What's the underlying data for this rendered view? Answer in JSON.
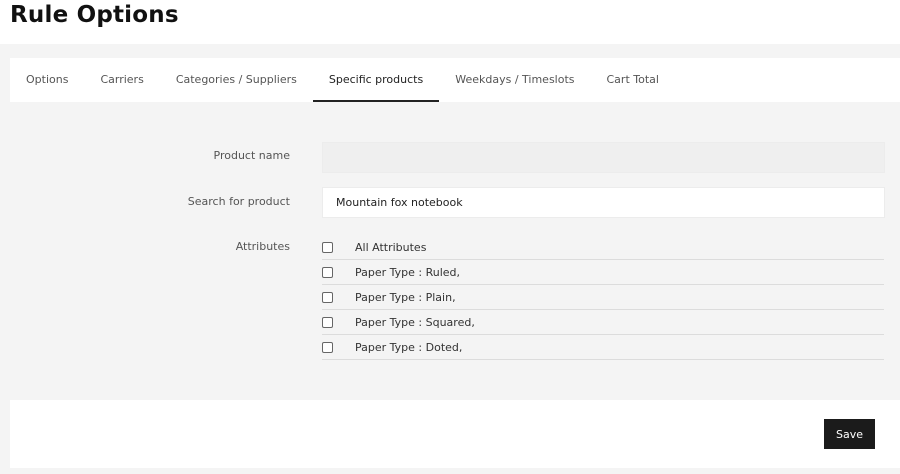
{
  "page": {
    "title": "Rule Options"
  },
  "tabs": [
    {
      "label": "Options"
    },
    {
      "label": "Carriers"
    },
    {
      "label": "Categories / Suppliers"
    },
    {
      "label": "Specific products",
      "active": true
    },
    {
      "label": "Weekdays / Timeslots"
    },
    {
      "label": "Cart Total"
    }
  ],
  "form": {
    "product_name": {
      "label": "Product name",
      "value": "",
      "placeholder": ""
    },
    "search": {
      "label": "Search for product",
      "value": "Mountain fox notebook",
      "placeholder": ""
    },
    "attributes": {
      "label": "Attributes",
      "items": [
        {
          "label": "All Attributes",
          "checked": false
        },
        {
          "label": "Paper Type : Ruled,",
          "checked": false
        },
        {
          "label": "Paper Type : Plain,",
          "checked": false
        },
        {
          "label": "Paper Type : Squared,",
          "checked": false
        },
        {
          "label": "Paper Type : Doted,",
          "checked": false
        }
      ]
    }
  },
  "footer": {
    "save_label": "Save"
  },
  "colors": {
    "accent": "#1b1b1b",
    "background": "#f4f4f4",
    "panel": "#ffffff"
  }
}
